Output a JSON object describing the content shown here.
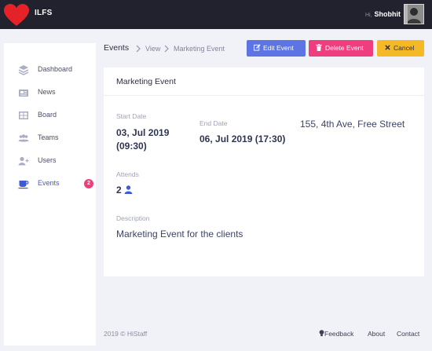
{
  "topbar": {
    "app_name": "ILFS",
    "greeting": "Hi,",
    "user_name": "Shobhit",
    "brand_color": "#e42227"
  },
  "sidebar": {
    "items": [
      {
        "label": "Dashboard",
        "icon": "layers-icon"
      },
      {
        "label": "News",
        "icon": "newspaper-icon"
      },
      {
        "label": "Board",
        "icon": "board-grid-icon"
      },
      {
        "label": "Teams",
        "icon": "teams-icon"
      },
      {
        "label": "Users",
        "icon": "user-plus-icon"
      },
      {
        "label": "Events",
        "icon": "coffee-cup-icon",
        "active": true,
        "badge": "2"
      }
    ]
  },
  "breadcrumb": {
    "section": "Events",
    "view": "View",
    "current": "Marketing Event"
  },
  "actions": {
    "edit": "Edit Event",
    "delete": "Delete Event",
    "cancel": "Cancel"
  },
  "event": {
    "title": "Marketing Event",
    "start_label": "Start Date",
    "start_date": "03, Jul 2019",
    "start_time": "(09:30)",
    "end_label": "End Date",
    "end_value": "06, Jul 2019 (17:30)",
    "location": "155, 4th Ave, Free Street",
    "attends_label": "Attends",
    "attends_count": "2",
    "description_label": "Description",
    "description": "Marketing Event for the clients"
  },
  "footer": {
    "copyright": "2019 © HiStaff",
    "links": [
      "Feedback",
      "About",
      "Contact"
    ]
  },
  "colors": {
    "accent": "#5c74e4",
    "danger": "#ef3e7e",
    "warning": "#f5b926",
    "topbar": "#21222d"
  }
}
